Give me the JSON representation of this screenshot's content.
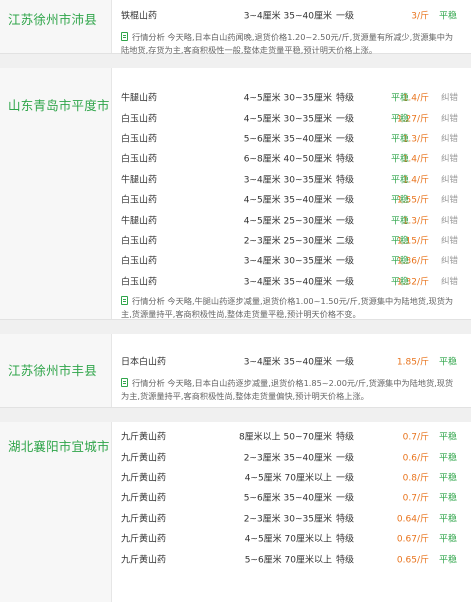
{
  "labels": {
    "trend": "平稳",
    "action": "纠错",
    "analysis_prefix": "行情分析"
  },
  "sections": [
    {
      "region": "江苏徐州市沛县",
      "rows": [
        {
          "variety": "铁棍山药",
          "spec": "3~4厘米 35~40厘米",
          "grade": "一级",
          "price": "3/斤"
        }
      ],
      "analysis": "今天略,日本白山药闻晚,退货价格1.20~2.50元/斤,货源量有所减少,货源集中为陆地货,存货为主,客商积极性一般,整体走货量平稳,预计明天价格上涨。"
    },
    {
      "region": "山东青岛市平度市",
      "rows": [
        {
          "variety": "牛腿山药",
          "spec": "4~5厘米 30~35厘米",
          "grade": "特级",
          "price": "1.4/斤"
        },
        {
          "variety": "白玉山药",
          "spec": "4~5厘米 30~35厘米",
          "grade": "一级",
          "price": "1.27/斤"
        },
        {
          "variety": "白玉山药",
          "spec": "5~6厘米 35~40厘米",
          "grade": "一级",
          "price": "1.3/斤"
        },
        {
          "variety": "白玉山药",
          "spec": "6~8厘米 40~50厘米",
          "grade": "特级",
          "price": "1.4/斤"
        },
        {
          "variety": "牛腿山药",
          "spec": "3~4厘米 30~35厘米",
          "grade": "特级",
          "price": "1.4/斤"
        },
        {
          "variety": "白玉山药",
          "spec": "4~5厘米 35~40厘米",
          "grade": "一级",
          "price": "1.55/斤"
        },
        {
          "variety": "牛腿山药",
          "spec": "4~5厘米 25~30厘米",
          "grade": "一级",
          "price": "1.3/斤"
        },
        {
          "variety": "白玉山药",
          "spec": "2~3厘米 25~30厘米",
          "grade": "二级",
          "price": "1.15/斤"
        },
        {
          "variety": "白玉山药",
          "spec": "3~4厘米 30~35厘米",
          "grade": "一级",
          "price": "1.36/斤"
        },
        {
          "variety": "白玉山药",
          "spec": "3~4厘米 35~40厘米",
          "grade": "一级",
          "price": "1.32/斤"
        }
      ],
      "analysis": "今天略,牛腿山药逐步减量,退货价格1.00~1.50元/斤,货源集中为陆地货,现货为主,货源量持平,客商积极性尚,整体走货量平稳,预计明天价格不变。"
    },
    {
      "region": "江苏徐州市丰县",
      "rows": [
        {
          "variety": "日本白山药",
          "spec": "3~4厘米 35~40厘米",
          "grade": "一级",
          "price": "1.85/斤"
        }
      ],
      "analysis": "今天略,日本白山药逐步减量,退货价格1.85~2.00元/斤,货源集中为陆地货,现货为主,货源量持平,客商积极性尚,整体走货量偏快,预计明天价格上涨。"
    },
    {
      "region": "湖北襄阳市宜城市",
      "rows": [
        {
          "variety": "九斤黄山药",
          "spec": "8厘米以上 50~70厘米",
          "grade": "特级",
          "price": "0.7/斤"
        },
        {
          "variety": "九斤黄山药",
          "spec": "2~3厘米 35~40厘米",
          "grade": "一级",
          "price": "0.6/斤"
        },
        {
          "variety": "九斤黄山药",
          "spec": "4~5厘米 70厘米以上",
          "grade": "一级",
          "price": "0.8/斤"
        },
        {
          "variety": "九斤黄山药",
          "spec": "5~6厘米 35~40厘米",
          "grade": "一级",
          "price": "0.7/斤"
        },
        {
          "variety": "九斤黄山药",
          "spec": "2~3厘米 30~35厘米",
          "grade": "特级",
          "price": "0.64/斤"
        },
        {
          "variety": "九斤黄山药",
          "spec": "4~5厘米 70厘米以上",
          "grade": "特级",
          "price": "0.67/斤"
        },
        {
          "variety": "九斤黄山药",
          "spec": "5~6厘米 70厘米以上",
          "grade": "特级",
          "price": "0.65/斤"
        }
      ]
    }
  ]
}
